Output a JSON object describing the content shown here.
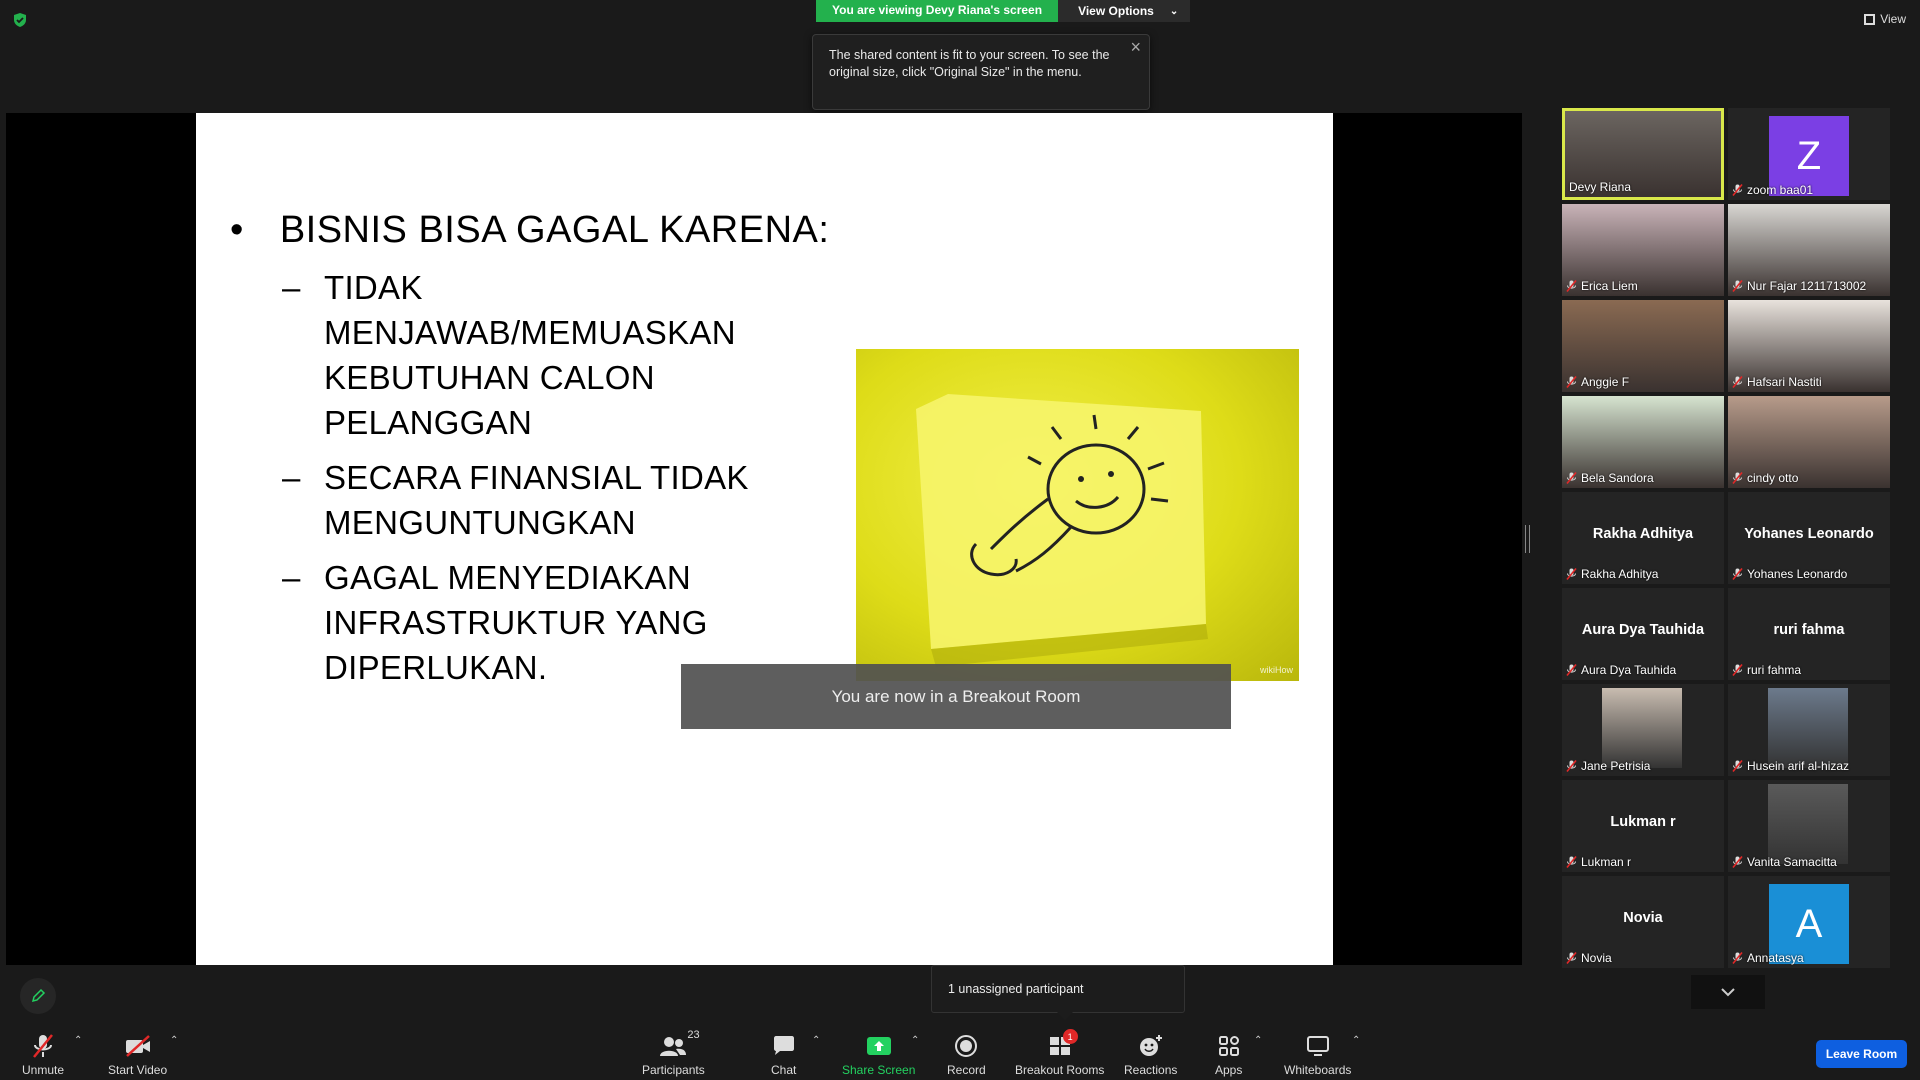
{
  "top": {
    "viewing_label": "You are viewing Devy Riana's screen",
    "view_options_label": "View Options",
    "tooltip_text": "The shared content is fit to your screen. To see the original size, click \"Original Size\" in the menu.",
    "view_label": "View"
  },
  "slide": {
    "main_bullet": "BISNIS BISA GAGAL KARENA:",
    "sub_bullets": [
      "TIDAK MENJAWAB/MEMUASKAN KEBUTUHAN CALON PELANGGAN",
      "SECARA FINANSIAL TIDAK MENGUNTUNGKAN",
      "GAGAL MENYEDIAKAN INFRASTRUKTUR YANG DIPERLUKAN."
    ],
    "image_watermark": "wikiHow"
  },
  "breakout_message": "You are now in a Breakout Room",
  "participants": [
    {
      "name": "Devy Riana",
      "type": "video",
      "muted": false,
      "bg": "#6b6560"
    },
    {
      "name": "zoom baa01",
      "type": "avatar",
      "letter": "Z",
      "avatar_color": "#7b3fe4",
      "muted": true
    },
    {
      "name": "Erica Liem",
      "type": "video",
      "muted": true,
      "bg": "#c9b3b8"
    },
    {
      "name": "Nur Fajar 1211713002",
      "type": "video",
      "muted": true,
      "bg": "#d8d6d2"
    },
    {
      "name": "Anggie F",
      "type": "video",
      "muted": true,
      "bg": "#8a6a52"
    },
    {
      "name": "Hafsari Nastiti",
      "type": "video",
      "muted": true,
      "bg": "#e8e2dc"
    },
    {
      "name": "Bela Sandora",
      "type": "video",
      "muted": true,
      "bg": "#d6e4d0"
    },
    {
      "name": "cindy otto",
      "type": "video",
      "muted": true,
      "bg": "#b79b8a"
    },
    {
      "name": "Rakha Adhitya",
      "type": "text",
      "muted": true
    },
    {
      "name": "Yohanes Leonardo",
      "type": "text",
      "muted": true
    },
    {
      "name": "Aura Dya Tauhida",
      "type": "text",
      "muted": true
    },
    {
      "name": "ruri fahma",
      "type": "text",
      "muted": true
    },
    {
      "name": "Jane Petrisia",
      "type": "photo",
      "muted": true,
      "bg": "#c8bcb0"
    },
    {
      "name": "Husein arif al-hizaz",
      "type": "photo",
      "muted": true,
      "bg": "#6c7a8c"
    },
    {
      "name": "Lukman r",
      "type": "text",
      "muted": true
    },
    {
      "name": "Vanita Samacitta",
      "type": "photo",
      "muted": true,
      "bg": "#5a5a5a"
    },
    {
      "name": "Novia",
      "type": "text",
      "muted": true
    },
    {
      "name": "Annatasya",
      "type": "avatar",
      "letter": "A",
      "avatar_color": "#1a8fd6",
      "muted": true
    }
  ],
  "unassigned_text": "1 unassigned participant",
  "toolbar": {
    "unmute": "Unmute",
    "start_video": "Start Video",
    "participants": "Participants",
    "participants_count": "23",
    "chat": "Chat",
    "share_screen": "Share Screen",
    "record": "Record",
    "breakout_rooms": "Breakout Rooms",
    "breakout_badge": "1",
    "reactions": "Reactions",
    "apps": "Apps",
    "whiteboards": "Whiteboards",
    "leave_room": "Leave Room"
  },
  "colors": {
    "accent_green": "#23b14d",
    "leave_blue": "#0e5fe0",
    "active_speaker": "#d9e84a",
    "muted_red": "#e02828"
  }
}
